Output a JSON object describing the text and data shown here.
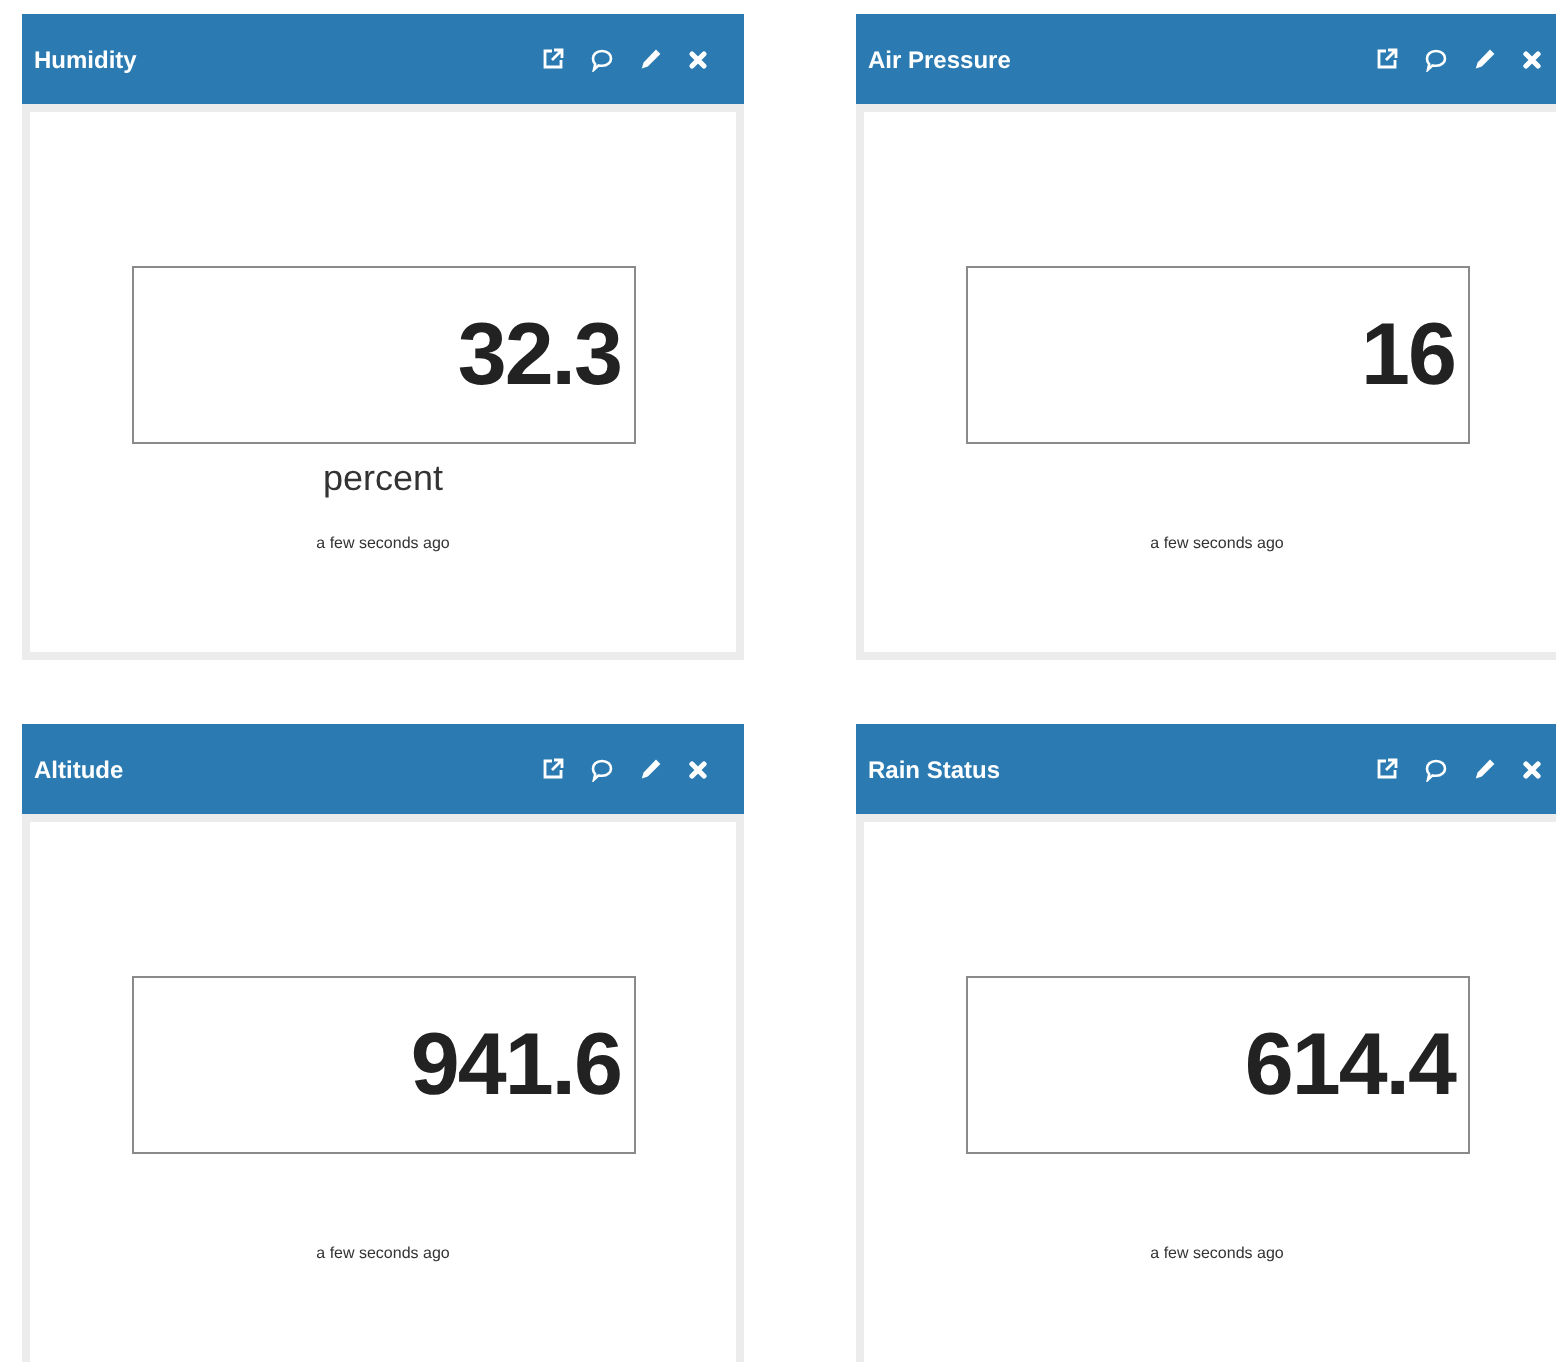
{
  "widgets": [
    {
      "title": "Humidity",
      "value": "32.3",
      "unit": "percent",
      "updated": "a few seconds ago"
    },
    {
      "title": "Air Pressure",
      "value": "16",
      "updated": "a few seconds ago"
    },
    {
      "title": "Altitude",
      "value": "941.6",
      "updated": "a few seconds ago"
    },
    {
      "title": "Rain Status",
      "value": "614.4",
      "updated": "a few seconds ago"
    }
  ]
}
